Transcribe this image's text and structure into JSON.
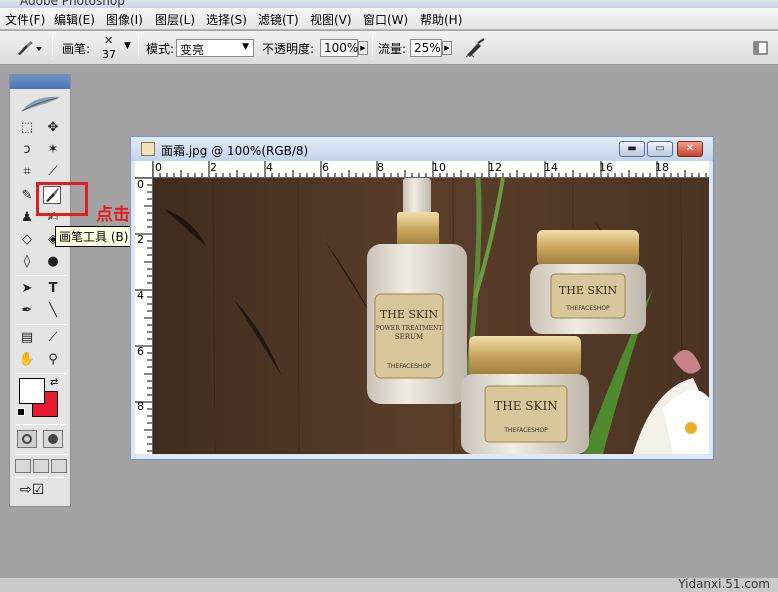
{
  "app": {
    "title": "Adobe Photoshop"
  },
  "menu": [
    "文件(F)",
    "编辑(E)",
    "图像(I)",
    "图层(L)",
    "选择(S)",
    "滤镜(T)",
    "视图(V)",
    "窗口(W)",
    "帮助(H)"
  ],
  "options": {
    "brush_label": "画笔:",
    "brush_size": "37",
    "mode_label": "模式:",
    "mode_value": "变亮",
    "opacity_label": "不透明度:",
    "opacity_value": "100%",
    "flow_label": "流量:",
    "flow_value": "25%"
  },
  "tooltip": "画笔工具 (B)",
  "instruction": "点击画笔工具",
  "document": {
    "title": "面霜.jpg @ 100%(RGB/8)",
    "ruler_h": [
      "0",
      "2",
      "4",
      "6",
      "8",
      "10",
      "12",
      "14",
      "16",
      "18"
    ],
    "ruler_v": [
      "0",
      "2",
      "4",
      "6",
      "8"
    ]
  },
  "product_labels": {
    "serum_brand": "THE SKIN",
    "serum_line1": "POWER TREATMENT",
    "serum_line2": "SERUM",
    "serum_shop": "THEFACESHOP",
    "jar1_brand": "THE SKIN",
    "jar1_shop": "THEFACESHOP",
    "jar2_brand": "THE SKIN",
    "jar2_shop": "THEFACESHOP"
  },
  "icons": [
    "brush-icon",
    "marquee-icon",
    "move-icon",
    "lasso-icon",
    "magic-wand-icon",
    "crop-icon",
    "slice-icon",
    "healing-icon",
    "stamp-icon",
    "eraser-icon",
    "blur-icon",
    "dodge-icon",
    "path-select-icon",
    "type-icon",
    "pen-icon",
    "line-icon",
    "notes-icon",
    "eyedropper-icon",
    "hand-icon",
    "zoom-icon",
    "airbrush-icon",
    "palette-icon"
  ],
  "colors": {
    "foreground": "#ffffff",
    "background": "#e8182f",
    "highlight": "#e02020"
  },
  "watermark": "Yidanxi.51.com"
}
